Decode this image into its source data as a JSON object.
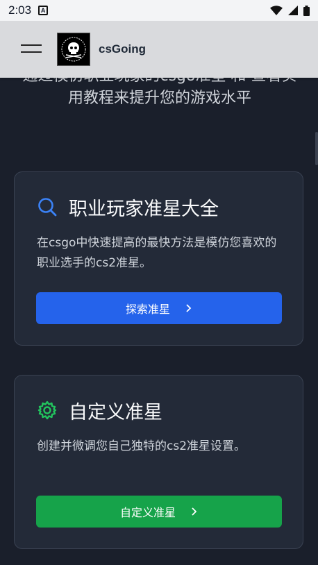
{
  "status_bar": {
    "time": "2:03",
    "a_badge": "A"
  },
  "header": {
    "site_name": "csGoing"
  },
  "intro": {
    "text": "通过模仿职业玩家的csgo准星 和 查看实用教程来提升您的游戏水平"
  },
  "cards": [
    {
      "title": "职业玩家准星大全",
      "description": "在csgo中快速提高的最快方法是模仿您喜欢的职业选手的cs2准星。",
      "button_label": "探索准星",
      "accent": "#2563eb",
      "icon": "search-icon"
    },
    {
      "title": "自定义准星",
      "description": "创建并微调您自己独特的cs2准星设置。",
      "button_label": "自定义准星",
      "accent": "#16a34a",
      "icon": "gear-icon"
    }
  ]
}
